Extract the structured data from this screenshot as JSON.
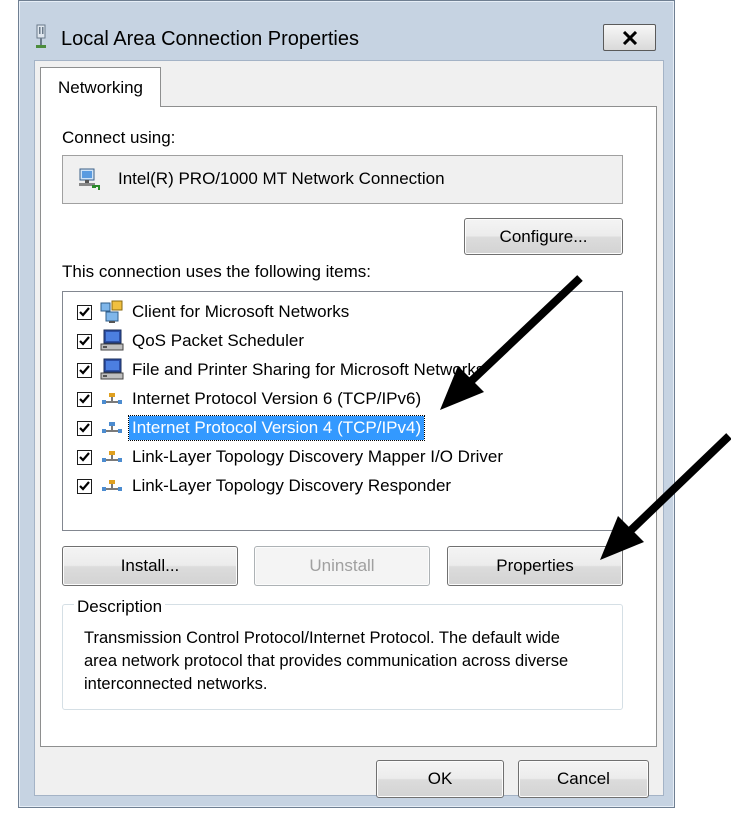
{
  "window": {
    "title": "Local Area Connection Properties",
    "close_glyph": "✕"
  },
  "tabs": [
    {
      "label": "Networking",
      "active": true
    }
  ],
  "connect_using": {
    "label": "Connect using:",
    "adapter": "Intel(R) PRO/1000 MT Network Connection",
    "adapter_icon": "network-adapter-icon"
  },
  "buttons": {
    "configure": "Configure...",
    "install": "Install...",
    "uninstall": "Uninstall",
    "properties": "Properties",
    "ok": "OK",
    "cancel": "Cancel"
  },
  "items_label": "This connection uses the following items:",
  "items": [
    {
      "label": "Client for Microsoft Networks",
      "checked": true,
      "icon": "network-client-icon"
    },
    {
      "label": "QoS Packet Scheduler",
      "checked": true,
      "icon": "computer-service-icon"
    },
    {
      "label": "File and Printer Sharing for Microsoft Networks",
      "checked": true,
      "icon": "computer-service-icon"
    },
    {
      "label": "Internet Protocol Version 6 (TCP/IPv6)",
      "checked": true,
      "icon": "protocol-icon"
    },
    {
      "label": "Internet Protocol Version 4 (TCP/IPv4)",
      "checked": true,
      "icon": "protocol-icon",
      "selected": true
    },
    {
      "label": "Link-Layer Topology Discovery Mapper I/O Driver",
      "checked": true,
      "icon": "protocol-icon"
    },
    {
      "label": "Link-Layer Topology Discovery Responder",
      "checked": true,
      "icon": "protocol-icon"
    }
  ],
  "description": {
    "legend": "Description",
    "text": "Transmission Control Protocol/Internet Protocol. The default wide area network protocol that provides communication across diverse interconnected networks."
  },
  "colors": {
    "selection": "#3399ff",
    "frame": "#c6d3e2",
    "arrow": "#000000"
  }
}
